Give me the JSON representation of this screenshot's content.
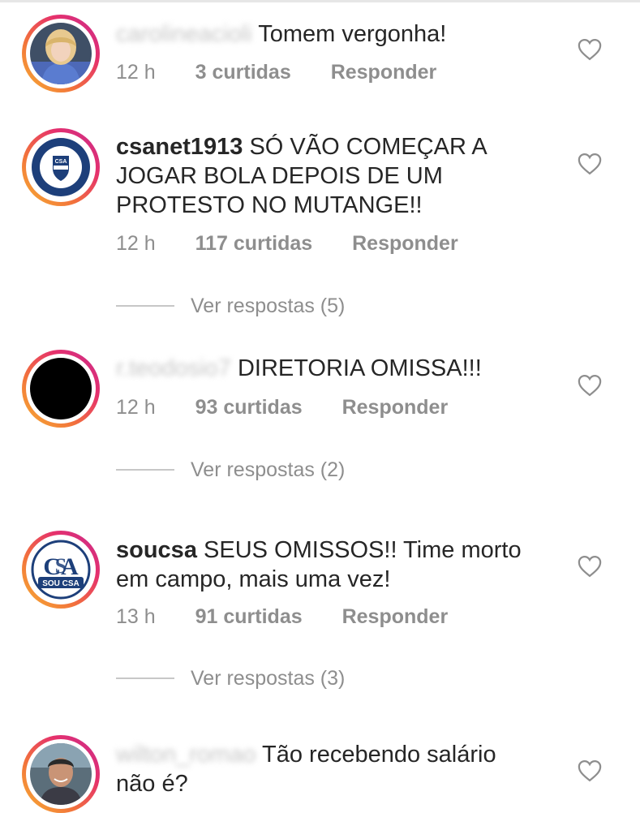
{
  "comments": [
    {
      "username": "carolineacioli",
      "text": "Tomem vergonha!",
      "time": "12 h",
      "likes": "3 curtidas",
      "reply": "Responder",
      "avatar": "woman-photo"
    },
    {
      "username": "csanet1913",
      "text": "SÓ VÃO COMEÇAR A JOGAR BOLA DEPOIS DE UM PROTESTO NO MUTANGE!!",
      "time": "12 h",
      "likes": "117 curtidas",
      "reply": "Responder",
      "view_replies": "Ver respostas (5)",
      "avatar": "club-crest"
    },
    {
      "username": "r.teodosio7",
      "text": "DIRETORIA OMISSA!!!",
      "time": "12 h",
      "likes": "93 curtidas",
      "reply": "Responder",
      "view_replies": "Ver respostas (2)",
      "avatar": "black-circle"
    },
    {
      "username": "soucsa",
      "text": "SEUS OMISSOS!! Time morto em campo, mais uma vez!",
      "time": "13 h",
      "likes": "91 curtidas",
      "reply": "Responder",
      "view_replies": "Ver respostas (3)",
      "avatar": "sou-csa-logo",
      "avatar_label": "SOU CSA"
    },
    {
      "username": "wilton_romao",
      "text": "Tão recebendo salário não é?",
      "avatar": "man-photo"
    }
  ],
  "colors": {
    "text": "#262626",
    "meta": "#8e8e8e",
    "ring_start": "#f7b233",
    "ring_end": "#c72d8f",
    "csa_blue": "#1d3f7a"
  }
}
